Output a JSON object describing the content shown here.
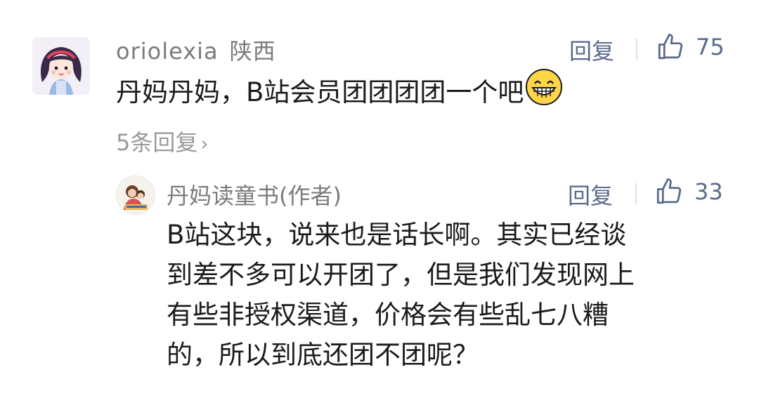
{
  "comment": {
    "username": "oriolexia",
    "location": "陕西",
    "reply_label": "回复",
    "like_count": "75",
    "text": "丹妈丹妈，B站会员团团团团一个吧",
    "emoji": "grin-emoji",
    "replies_link": "5条回复"
  },
  "reply": {
    "username": "丹妈读童书(作者)",
    "reply_label": "回复",
    "like_count": "33",
    "lines": [
      "B站这块，说来也是话长啊。其实已经谈",
      "到差不多可以开团了，但是我们发现网上",
      "有些非授权渠道，价格会有些乱七八糟",
      "的，所以到底还团不团呢？"
    ]
  },
  "colors": {
    "text": "#1b1b1b",
    "meta": "#7b7b7b",
    "action": "#5b6b8c",
    "reply_link": "#9a9a9a"
  }
}
